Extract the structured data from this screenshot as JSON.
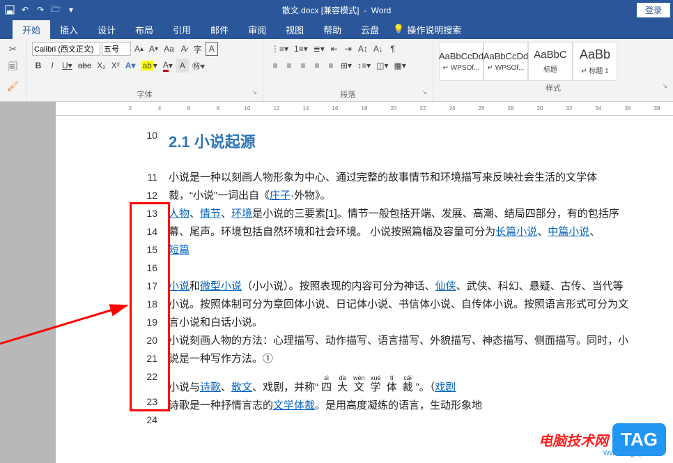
{
  "titlebar": {
    "filename": "散文.docx [兼容模式]",
    "appname": "Word",
    "login": "登录"
  },
  "tabs": {
    "items": [
      "开始",
      "插入",
      "设计",
      "布局",
      "引用",
      "邮件",
      "审阅",
      "视图",
      "帮助",
      "云盘"
    ],
    "active_index": 0,
    "tell_me": "操作说明搜索"
  },
  "ribbon": {
    "font": {
      "name": "Calibri (西文正文)",
      "size": "五号",
      "increase_a": "A",
      "decrease_a": "A",
      "aa": "Aa",
      "clear": "A",
      "phonetic": "字",
      "box": "A",
      "b": "B",
      "i": "I",
      "u": "U",
      "strike": "abc",
      "sub": "X₂",
      "sup": "X²",
      "text_effect": "A",
      "highlight": "A",
      "font_color": "A",
      "char_shade": "A",
      "char_border": "A",
      "label": "字体"
    },
    "para": {
      "bullet": "≡",
      "number": "≡",
      "multilevel": "≡",
      "dec_indent": "⇤",
      "inc_indent": "⇥",
      "sort": "A↓",
      "show_marks": "¶",
      "align_l": "≡",
      "align_c": "≡",
      "align_r": "≡",
      "justify": "≡",
      "distribute": "≡",
      "snap": "⊞",
      "line_space": "↕",
      "shading": "▦",
      "borders": "▦",
      "label": "段落"
    },
    "styles": {
      "items": [
        {
          "preview": "AaBbCcDd",
          "name": "↵ WPSOf...",
          "cls": ""
        },
        {
          "preview": "AaBbCcDd",
          "name": "↵ WPSOf...",
          "cls": ""
        },
        {
          "preview": "AaBbC",
          "name": "标题",
          "cls": "medium"
        },
        {
          "preview": "AaBb",
          "name": "↵ 标题 1",
          "cls": "big"
        }
      ],
      "label": "样式"
    }
  },
  "document": {
    "heading_num": "2.1",
    "heading_text": "小说起源",
    "line_nums": [
      "10",
      "11",
      "12",
      "13",
      "14",
      "15",
      "16",
      "17",
      "18",
      "19",
      "20",
      "21",
      "22",
      "23",
      "24"
    ],
    "para1_a": "小说是一种以刻画人物形象为中心、通过完整的故事情节和环境描写来反映社会生活的文学体裁，“小说”一词出自《",
    "link_zhuangzi": "庄子",
    "para1_b": "·外物》。",
    "link_renwu": "人物",
    "sep1": "、",
    "link_qingjie": "情节",
    "sep2": "、",
    "link_huanjing": "环境",
    "para2_a": "是小说的三要素[1]。情节一般包括开端、发展、高潮、结局四部分，有的包括序幕、尾声。环境包括自然环境和社会环境。 小说按照篇幅及容量可分为",
    "link_changpian": "长篇小说",
    "sep3": "、",
    "link_zhongpian": "中篇小说",
    "sep4": "、",
    "link_duanpian": "短篇",
    "link_xiaoshuo": "小说",
    "para3_a": "和",
    "link_weixing": "微型小说",
    "para3_b": "（小小说）。按照表现的内容可分为神话、",
    "link_xianxia": "仙侠",
    "para3_c": "、武侠、科幻、悬疑、古传、当代等小说。按照体制可分为章回体小说、日记体小说、书信体小说、自传体小说。按照语言形式可分为文言小说和白话小说。",
    "para4": "小说刻画人物的方法：心理描写、动作描写、语言描写、外貌描写、神态描写、侧面描写。同时，小说是一种写作方法。①",
    "para5_a": "小说与",
    "link_shige": "诗歌",
    "para5_b": "、",
    "link_sanwen": "散文",
    "para5_c": "、戏剧，并称“",
    "ruby_chars": [
      "四",
      "大",
      "文",
      "学",
      "体",
      "裁"
    ],
    "ruby_ann": [
      "sì",
      "dà",
      "wén",
      "xué",
      "tǐ",
      "cái"
    ],
    "para5_d": "”。（",
    "link_xiju": "戏剧",
    "para6_a": "诗歌是一种抒情言志的",
    "link_wenxue": "文学体裁",
    "para6_b": "。是用高度凝练的语言，生动形象地"
  },
  "watermark": {
    "site_name": "电脑技术网",
    "tag": "TAG",
    "url": "www.tagxp.com"
  }
}
